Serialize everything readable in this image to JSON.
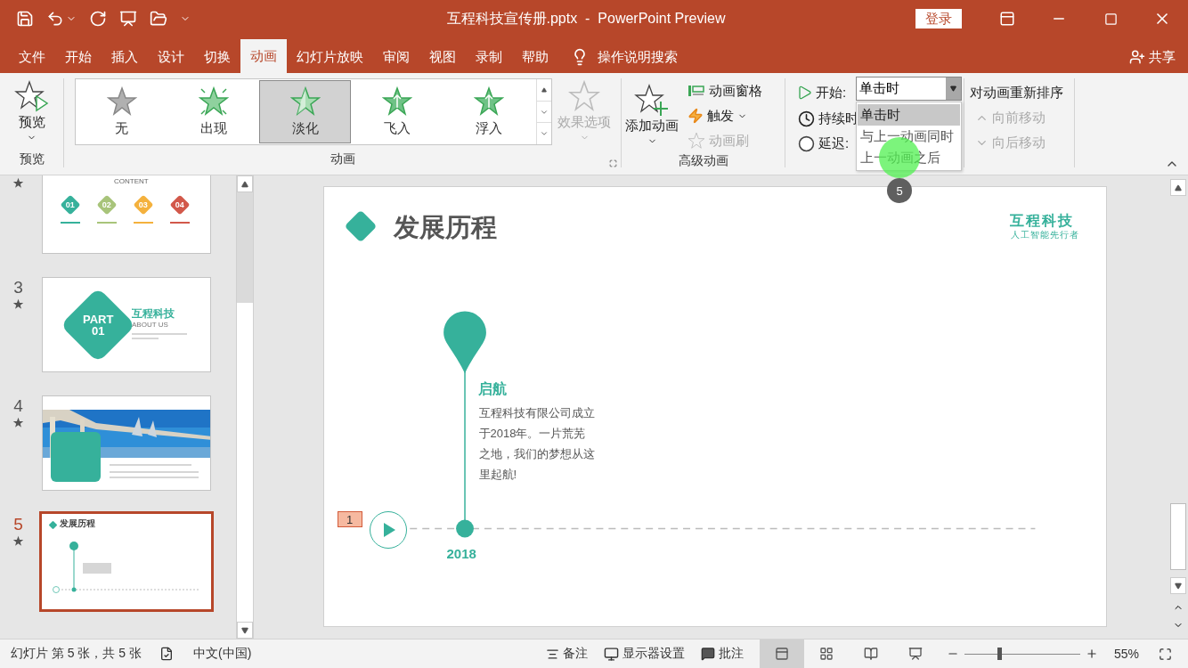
{
  "title_bar": {
    "title": "互程科技宣传册.pptx  -  PowerPoint Preview",
    "login": "登录"
  },
  "tabs": [
    {
      "label": "文件",
      "selected": false
    },
    {
      "label": "开始",
      "selected": false
    },
    {
      "label": "插入",
      "selected": false
    },
    {
      "label": "设计",
      "selected": false
    },
    {
      "label": "切换",
      "selected": false
    },
    {
      "label": "动画",
      "selected": true
    },
    {
      "label": "幻灯片放映",
      "selected": false
    },
    {
      "label": "审阅",
      "selected": false
    },
    {
      "label": "视图",
      "selected": false
    },
    {
      "label": "录制",
      "selected": false
    },
    {
      "label": "帮助",
      "selected": false
    }
  ],
  "tell_me": "操作说明搜索",
  "share": "共享",
  "ribbon": {
    "preview": {
      "button": "预览",
      "group": "预览"
    },
    "animations": {
      "group": "动画",
      "effect_options": {
        "label": "效果选项",
        "disabled": true
      },
      "items": [
        {
          "label": "无",
          "kind": "none",
          "selected": false
        },
        {
          "label": "出现",
          "kind": "appear",
          "selected": false
        },
        {
          "label": "淡化",
          "kind": "fade",
          "selected": true
        },
        {
          "label": "飞入",
          "kind": "fly",
          "selected": false
        },
        {
          "label": "浮入",
          "kind": "float",
          "selected": false
        }
      ]
    },
    "advanced": {
      "group": "高级动画",
      "add": "添加动画",
      "items": [
        {
          "label": "动画窗格",
          "kind": "pane",
          "disabled": false,
          "menu": false
        },
        {
          "label": "触发",
          "kind": "trigger",
          "disabled": false,
          "menu": true
        },
        {
          "label": "动画刷",
          "kind": "painter",
          "disabled": true,
          "menu": false
        }
      ]
    },
    "timing": {
      "start_label": "开始:",
      "start_value": "单击时",
      "duration_label": "持续时",
      "delay_label": "延迟:",
      "options": [
        {
          "label": "单击时",
          "selected": true
        },
        {
          "label": "与上一动画同时",
          "selected": false
        },
        {
          "label": "上一动画之后",
          "selected": false
        }
      ]
    },
    "reorder": {
      "title": "对动画重新排序",
      "items": [
        {
          "label": "向前移动",
          "kind": "up",
          "disabled": true
        },
        {
          "label": "向后移动",
          "kind": "down",
          "disabled": true
        }
      ]
    }
  },
  "click_marker": "5",
  "thumbnails": [
    {
      "kind": "toc",
      "animated": true,
      "selected": false,
      "caption": "CONTENT",
      "badges": [
        {
          "label": "01",
          "color": "#36b19b"
        },
        {
          "label": "02",
          "color": "#a8c47a"
        },
        {
          "label": "03",
          "color": "#f4b13d"
        },
        {
          "label": "04",
          "color": "#d2584a"
        }
      ]
    },
    {
      "number": "3",
      "kind": "part",
      "animated": true,
      "selected": false,
      "part": "PART",
      "part_number": "01",
      "heading": "互程科技",
      "subheading": "ABOUT US"
    },
    {
      "number": "4",
      "animated": true,
      "selected": false
    },
    {
      "number": "5",
      "kind": "timeline",
      "animated": true,
      "selected": true,
      "heading": "发展历程"
    }
  ],
  "slide": {
    "title": "发展历程",
    "logo": "互程科技",
    "tagline": "人工智能先行者",
    "event_title": "启航",
    "event_lines": [
      "互程科技有限公司成立",
      "于2018年。一片荒芜",
      "之地，我们的梦想从这",
      "里起航!"
    ],
    "year": "2018",
    "animation_tag": "1"
  },
  "status_bar": {
    "slide_info": "幻灯片 第 5 张，共 5 张",
    "language": "中文(中国)",
    "notes": "备注",
    "display": "显示器设置",
    "comments": "批注",
    "views": [
      {
        "kind": "normal",
        "selected": true
      },
      {
        "kind": "sorter",
        "selected": false
      },
      {
        "kind": "reading",
        "selected": false
      },
      {
        "kind": "show",
        "selected": false
      }
    ],
    "zoom": {
      "level": 0.3
    },
    "zoom_text": "55%"
  }
}
